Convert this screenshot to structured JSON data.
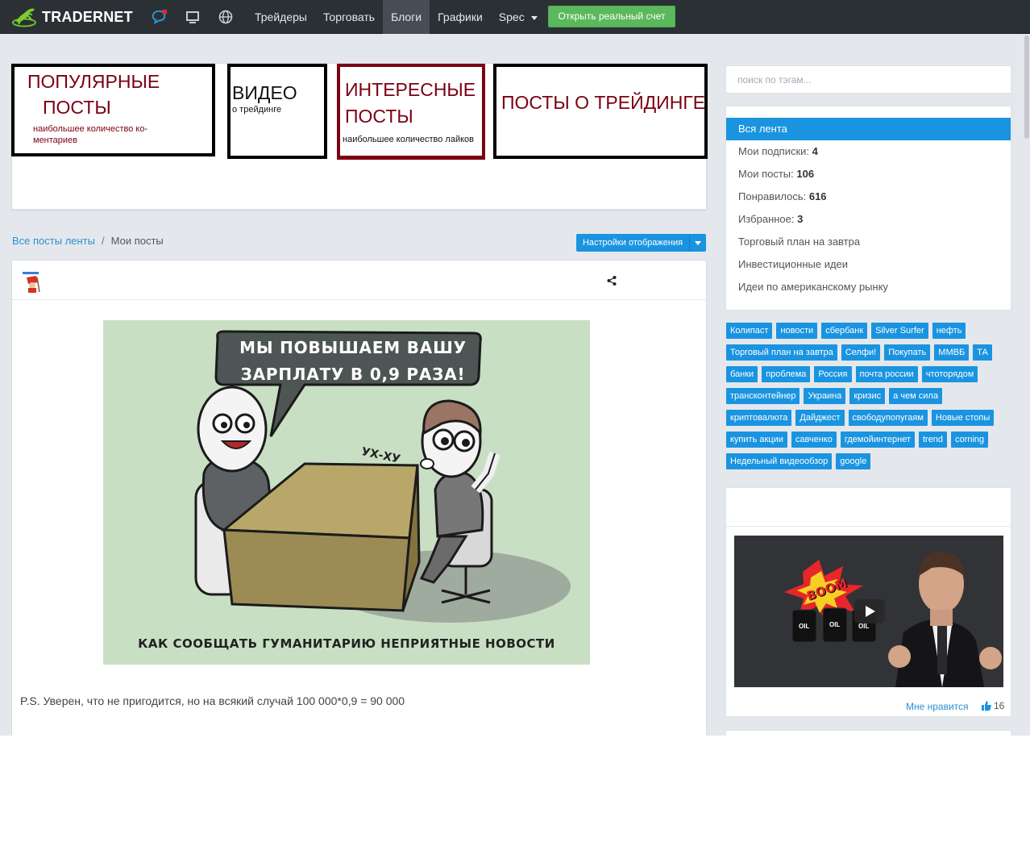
{
  "brand": {
    "name": "TRADERNET"
  },
  "nav": {
    "items": [
      {
        "label": "Трейдеры",
        "active": false
      },
      {
        "label": "Торговать",
        "active": false
      },
      {
        "label": "Блоги",
        "active": true
      },
      {
        "label": "Графики",
        "active": false
      },
      {
        "label": "Spec",
        "active": false,
        "dropdown": true
      }
    ],
    "open_account_label": "Открыть реальный счет",
    "icons": [
      "chat-icon",
      "monitor-icon",
      "globe-icon"
    ]
  },
  "banners": {
    "popular": {
      "title_line1": "ПОПУЛЯРНЫЕ",
      "title_line2": "ПОСТЫ",
      "subtitle_line1": "наибольшее количество ко-",
      "subtitle_line2": "ментариев"
    },
    "video": {
      "title": "ВИДЕО",
      "subtitle": "о трейдинге"
    },
    "interesting": {
      "title_line1": "ИНТЕРЕСНЫЕ",
      "title_line2": "ПОСТЫ",
      "subtitle": "наибольшее количество лайков"
    },
    "trading": {
      "title": "ПОСТЫ О ТРЕЙДИНГЕ"
    }
  },
  "breadcrumb": {
    "root": "Все посты ленты",
    "separator": "/",
    "current": "Мои посты"
  },
  "display_settings_label": "Настройки отображения",
  "post": {
    "image": {
      "bubble_line1": "МЫ ПОВЫШАЕМ ВАШУ",
      "bubble_line2": "ЗАРПЛАТУ В 0,9 РАЗА!",
      "sound": "УХ-ХУ",
      "caption": "КАК СООБЩАТЬ ГУМАНИТАРИЮ НЕПРИЯТНЫЕ НОВОСТИ"
    },
    "text": "P.S. Уверен, что не пригодится, но на всякий случай 100 000*0,9 = 90 000"
  },
  "sidebar": {
    "search_placeholder": "поиск по тэгам...",
    "feed": [
      {
        "label": "Вся лента",
        "count": "",
        "active": true
      },
      {
        "label": "Мои подписки: ",
        "count": "4"
      },
      {
        "label": "Мои посты: ",
        "count": "106"
      },
      {
        "label": "Понравилось: ",
        "count": "616"
      },
      {
        "label": "Избранное: ",
        "count": "3"
      },
      {
        "label": "Торговый план на завтра",
        "count": ""
      },
      {
        "label": "Инвестиционные идеи",
        "count": ""
      },
      {
        "label": "Идеи по американскому рынку",
        "count": ""
      }
    ],
    "tags": [
      [
        "Колипаст",
        "новости",
        "сбербанк",
        "Silver Surfer",
        "нефть"
      ],
      [
        "Торговый план на завтра",
        "Селфи!",
        "Покупать",
        "ММВБ",
        "ТА"
      ],
      [
        "банки",
        "проблема",
        "Россия",
        "почта россии",
        "чтоторядом"
      ],
      [
        "трансконтейнер",
        "Украина",
        "кризис",
        "а чем сила"
      ],
      [
        "криптовалюта",
        "Дайджест",
        "свободупопугаям",
        "Новые стопы"
      ],
      [
        "купить акции",
        "савченко",
        "гдемойинтернет",
        "trend",
        "corning"
      ],
      [
        "Недельный видеообзор",
        "google"
      ]
    ],
    "video": {
      "overlay_text": "BOOM",
      "barrel_label": "OIL",
      "like_label": "Мне нравится",
      "like_count": "16"
    }
  },
  "colors": {
    "accent": "#1a94e0",
    "nav_bg": "#2b3035",
    "cta": "#5cb85c",
    "banner_red": "#7b0012"
  }
}
